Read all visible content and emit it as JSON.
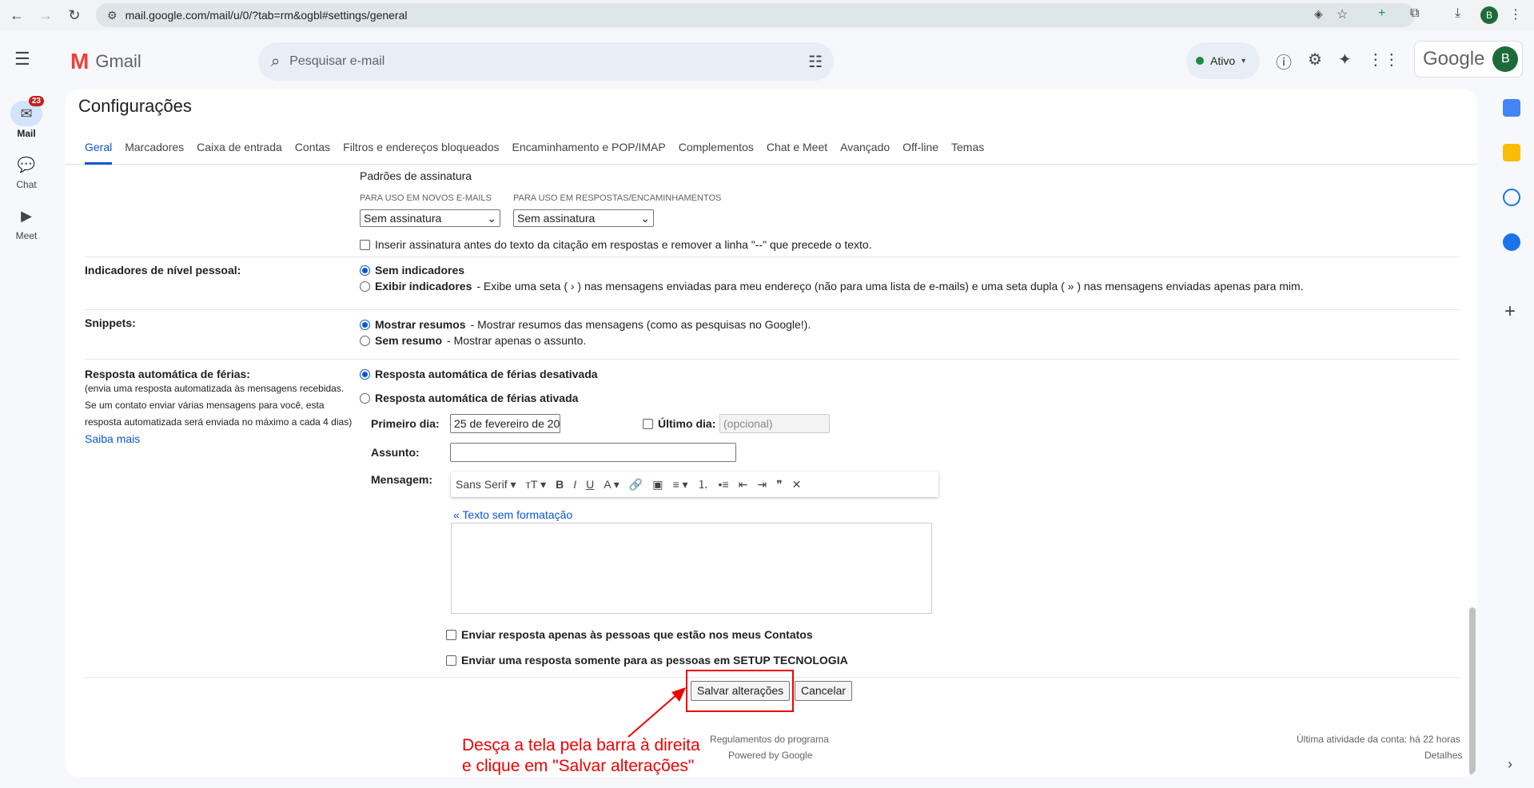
{
  "browser": {
    "url": "mail.google.com/mail/u/0/?tab=rm&ogbl#settings/general",
    "profile_initial": "B"
  },
  "header": {
    "app_name": "Gmail",
    "search_placeholder": "Pesquisar e-mail",
    "status": "Ativo",
    "google_word": "Google",
    "avatar_initial": "B"
  },
  "rail": {
    "mail_label": "Mail",
    "mail_badge": "23",
    "chat_label": "Chat",
    "meet_label": "Meet"
  },
  "page": {
    "title": "Configurações",
    "tabs": [
      "Geral",
      "Marcadores",
      "Caixa de entrada",
      "Contas",
      "Filtros e endereços bloqueados",
      "Encaminhamento e POP/IMAP",
      "Complementos",
      "Chat e Meet",
      "Avançado",
      "Off-line",
      "Temas"
    ]
  },
  "signature": {
    "heading": "Padrões de assinatura",
    "new_label": "PARA USO EM NOVOS E-MAILS",
    "reply_label": "PARA USO EM RESPOSTAS/ENCAMINHAMENTOS",
    "new_value": "Sem assinatura",
    "reply_value": "Sem assinatura",
    "insert_before": "Inserir assinatura antes do texto da citação em respostas e remover a linha \"--\" que precede o texto."
  },
  "indicators": {
    "label": "Indicadores de nível pessoal:",
    "opt1": "Sem indicadores",
    "opt2_bold": "Exibir indicadores",
    "opt2_rest": "- Exibe uma seta ( › ) nas mensagens enviadas para meu endereço (não para uma lista de e-mails) e uma seta dupla ( » ) nas mensagens enviadas apenas para mim."
  },
  "snippets": {
    "label": "Snippets:",
    "opt1_bold": "Mostrar resumos",
    "opt1_rest": "- Mostrar resumos das mensagens (como as pesquisas no Google!).",
    "opt2_bold": "Sem resumo",
    "opt2_rest": "- Mostrar apenas o assunto."
  },
  "vacation": {
    "label": "Resposta automática de férias:",
    "sub1": "(envia uma resposta automatizada às mensagens recebidas.",
    "sub2": "Se um contato enviar várias mensagens para você, esta",
    "sub3": "resposta automatizada será enviada no máximo a cada 4 dias)",
    "learn_more": "Saiba mais",
    "off": "Resposta automática de férias desativada",
    "on": "Resposta automática de férias ativada",
    "first_day_label": "Primeiro dia:",
    "first_day_value": "25 de fevereiro de 20",
    "last_day_label": "Último dia:",
    "last_day_placeholder": "(opcional)",
    "subject_label": "Assunto:",
    "message_label": "Mensagem:",
    "font": "Sans Serif",
    "plain_text": "« Texto sem formatação",
    "contacts_only": "Enviar resposta apenas às pessoas que estão nos meus Contatos",
    "org_only_prefix": "Enviar uma resposta somente para as pessoas em ",
    "org_name": "SETUP TECNOLOGIA"
  },
  "actions": {
    "save": "Salvar alterações",
    "cancel": "Cancelar"
  },
  "footer": {
    "program_policies": "Regulamentos do programa",
    "powered": "Powered by Google",
    "last_activity": "Última atividade da conta: há 22 horas",
    "details": "Detalhes"
  },
  "annotation": {
    "line1": "Desça a tela pela barra à direita",
    "line2": "e clique em \"Salvar alterações\"",
    "color": "#ee0000"
  }
}
